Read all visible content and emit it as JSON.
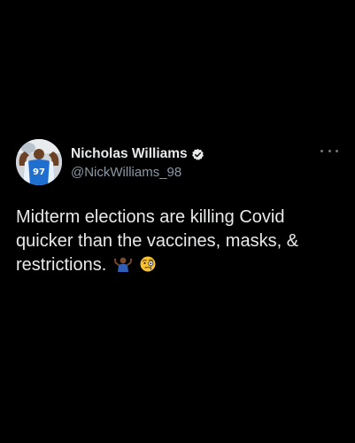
{
  "author": {
    "display_name": "Nicholas Williams",
    "handle": "@NickWilliams_98",
    "verified": true,
    "avatar_jersey": "97"
  },
  "tweet": {
    "text": "Midterm elections are killing Covid quicker than the vaccines, masks, & restrictions.",
    "emojis": [
      "person-shrugging-emoji",
      "face-with-monocle-emoji"
    ]
  },
  "icons": {
    "verified": "verified-badge-icon",
    "more": "more-options-icon"
  },
  "colors": {
    "background": "#000000",
    "text_primary": "#e7e9ea",
    "text_secondary": "#8b98a5",
    "verified_badge": "#e7e9ea"
  }
}
